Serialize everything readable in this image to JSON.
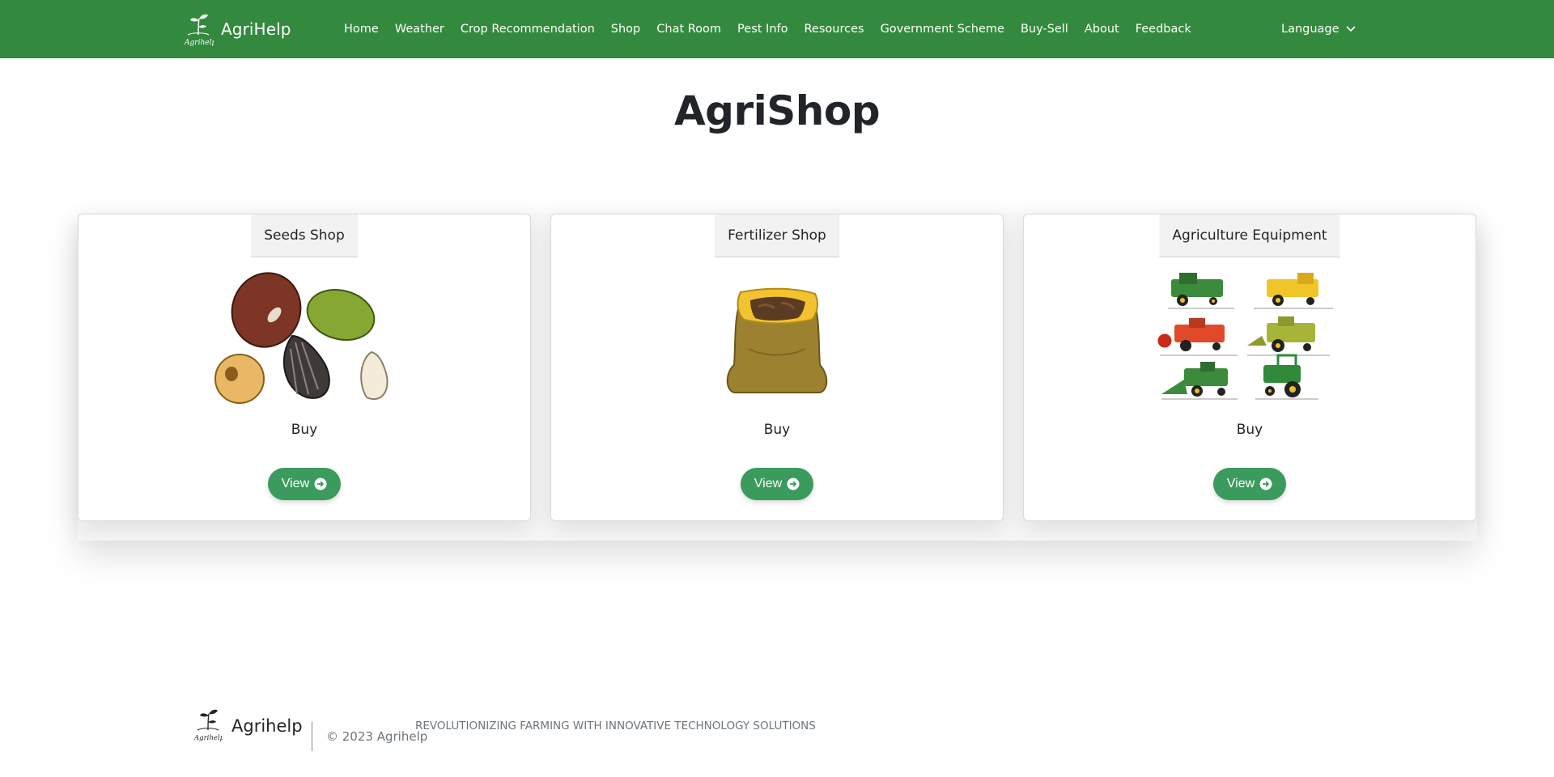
{
  "navbar": {
    "brand": "AgriHelp",
    "links": [
      "Home",
      "Weather",
      "Crop Recommendation",
      "Shop",
      "Chat Room",
      "Pest Info",
      "Resources",
      "Government Scheme",
      "Buy-Sell",
      "About",
      "Feedback"
    ],
    "language_label": "Language",
    "bg_color": "#338a3e"
  },
  "page": {
    "title": "AgriShop"
  },
  "cards": [
    {
      "header": "Seeds Shop",
      "image": "seeds-illustration",
      "caption": "Buy",
      "button": "View"
    },
    {
      "header": "Fertilizer Shop",
      "image": "fertilizer-sack-illustration",
      "caption": "Buy",
      "button": "View"
    },
    {
      "header": "Agriculture Equipment",
      "image": "farm-machinery-illustration",
      "caption": "Buy",
      "button": "View"
    }
  ],
  "footer": {
    "brand": "Agrihelp",
    "copyright": "© 2023 Agrihelp",
    "tagline": "REVOLUTIONIZING FARMING WITH INNOVATIVE TECHNOLOGY SOLUTIONS"
  },
  "colors": {
    "accent_button": "#3a9b5c",
    "nav_green": "#338a3e"
  }
}
